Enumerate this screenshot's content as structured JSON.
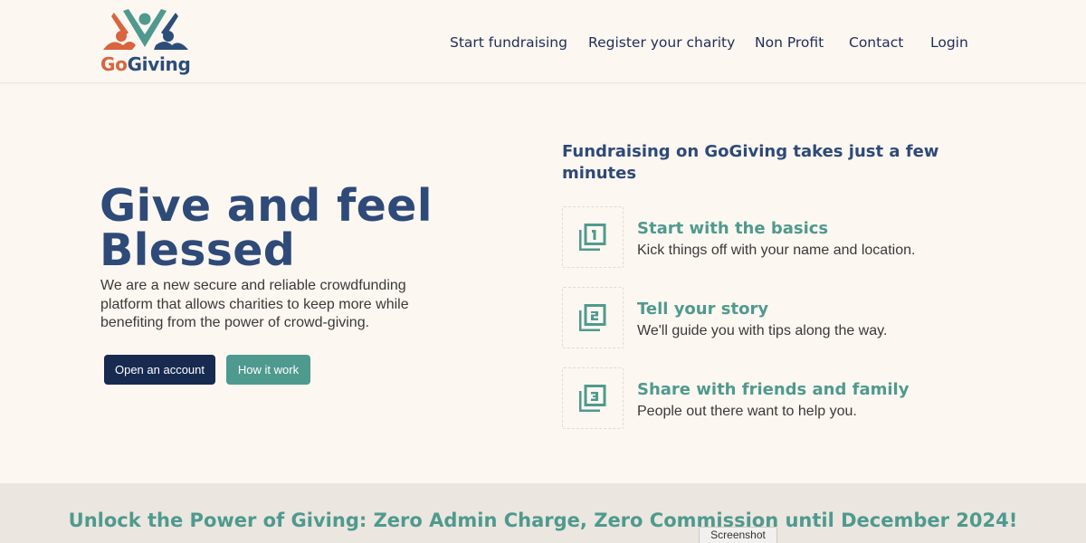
{
  "brand": {
    "logo_go": "Go",
    "logo_giving": "Giving",
    "color_orange": "#d9643e",
    "color_teal": "#4f9a8e",
    "color_navy": "#2c4d78"
  },
  "nav": {
    "items": [
      "Start fundraising",
      "Register your charity",
      "Non Profit",
      "Contact",
      "Login"
    ]
  },
  "hero": {
    "title_line1": "Give and feel",
    "title_line2": "Blessed",
    "description": "We are a new secure and reliable crowdfunding platform that allows charities to keep more while benefiting from the power of crowd-giving.",
    "primary_button": "Open an account",
    "secondary_button": "How it work"
  },
  "steps": {
    "heading": "Fundraising on GoGiving takes just a few minutes",
    "items": [
      {
        "number": "1",
        "icon": "filter-1-icon",
        "title": "Start with the basics",
        "description": "Kick things off with your name and location."
      },
      {
        "number": "2",
        "icon": "filter-2-icon",
        "title": "Tell your story",
        "description": "We'll guide you with tips along the way."
      },
      {
        "number": "3",
        "icon": "filter-3-icon",
        "title": "Share with friends and family",
        "description": "People out there want to help you."
      }
    ]
  },
  "banner": {
    "text": "Unlock the Power of Giving: Zero Admin Charge, Zero Commission until December 2024!"
  },
  "overlay": {
    "screenshot_tab": "Screenshot"
  }
}
